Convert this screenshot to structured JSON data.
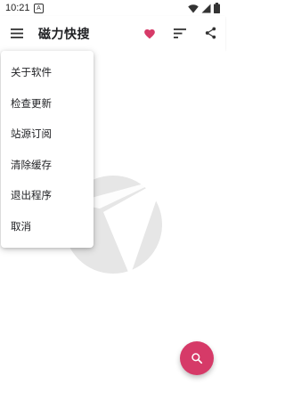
{
  "status_bar": {
    "time": "10:21",
    "notification_letter": "A"
  },
  "toolbar": {
    "title": "磁力快搜"
  },
  "menu": {
    "items": [
      {
        "label": "关于软件"
      },
      {
        "label": "检查更新"
      },
      {
        "label": "站源订阅"
      },
      {
        "label": "清除缓存"
      },
      {
        "label": "退出程序"
      },
      {
        "label": "取消"
      }
    ]
  },
  "icons": {
    "menu": "hamburger-icon",
    "favorite": "heart-icon",
    "sort": "sort-icon",
    "share": "share-icon",
    "search": "search-icon"
  },
  "colors": {
    "accent": "#d63a68",
    "watermark": "#e6e6e6"
  }
}
